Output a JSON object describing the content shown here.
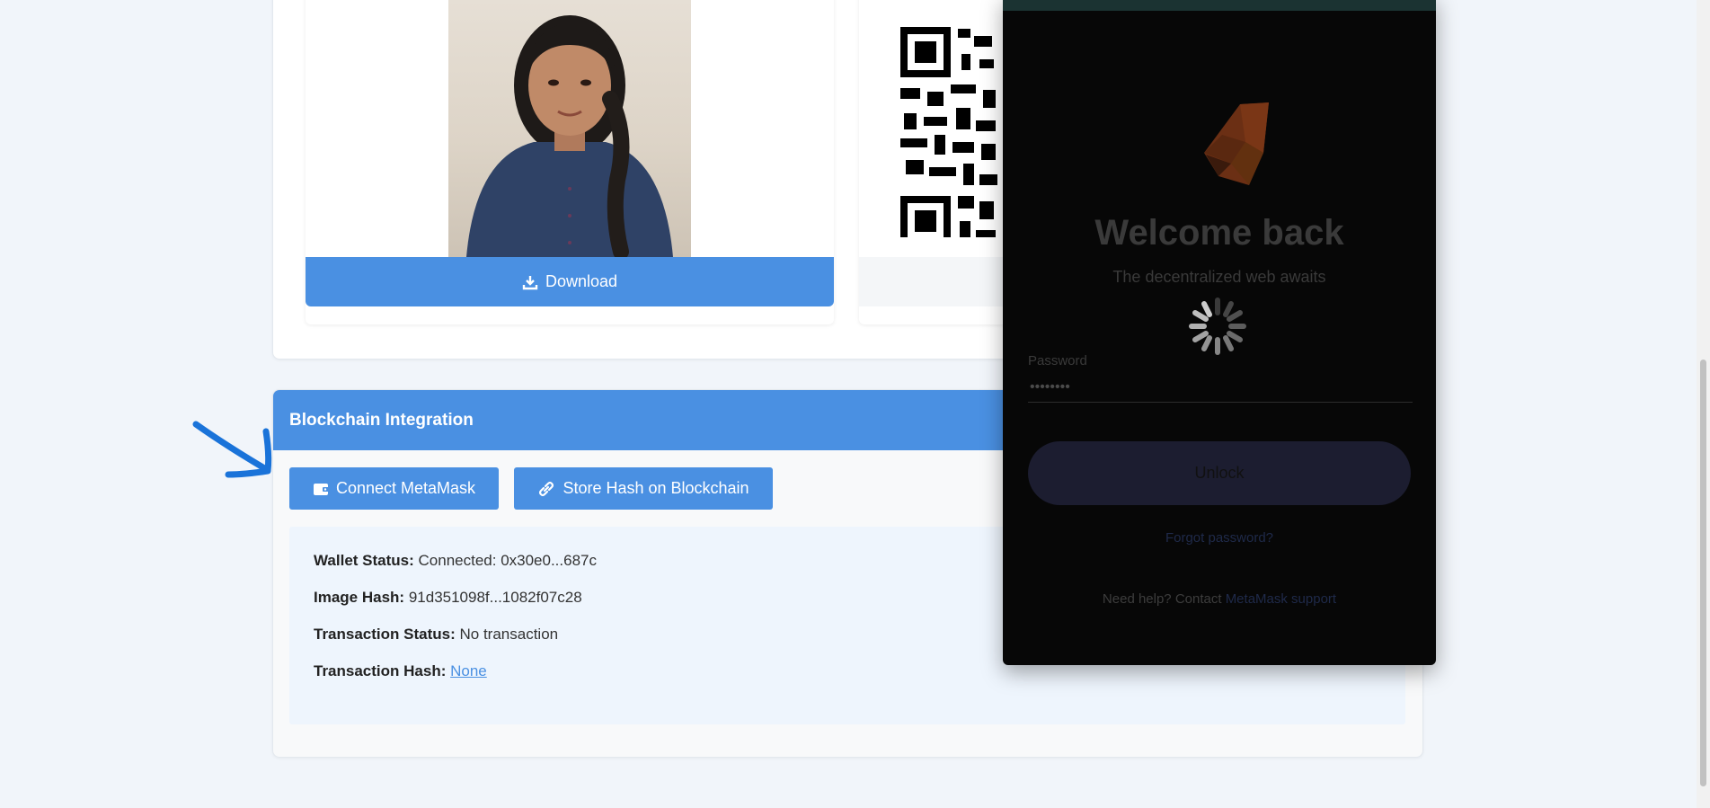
{
  "photo_card": {
    "download_label": "Download"
  },
  "blockchain": {
    "title": "Blockchain Integration",
    "connect_label": "Connect MetaMask",
    "store_label": "Store Hash on Blockchain",
    "wallet_status_label": "Wallet Status:",
    "wallet_status_value": "Connected: 0x30e0...687c",
    "image_hash_label": "Image Hash:",
    "image_hash_value": "91d351098f...1082f07c28",
    "tx_status_label": "Transaction Status:",
    "tx_status_value": "No transaction",
    "tx_hash_label": "Transaction Hash:",
    "tx_hash_value": "None"
  },
  "metamask": {
    "title": "Welcome back",
    "subtitle": "The decentralized web awaits",
    "password_label": "Password",
    "password_value": "••••••••",
    "unlock_label": "Unlock",
    "forgot_label": "Forgot password?",
    "help_text": "Need help? Contact ",
    "help_link": "MetaMask support"
  },
  "colors": {
    "accent": "#4a90e2",
    "annotation_arrow": "#1a73d9",
    "metamask_bg": "#070707"
  }
}
